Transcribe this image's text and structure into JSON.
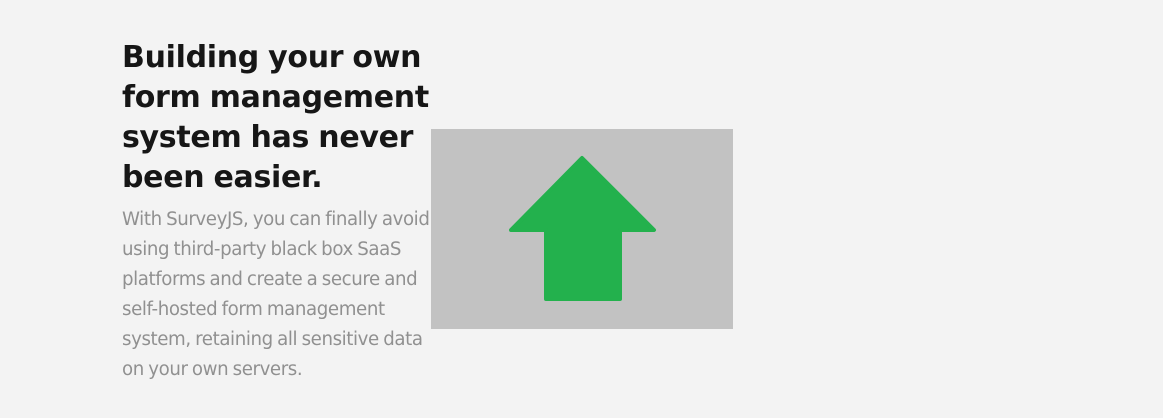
{
  "hero": {
    "title": "Building your own form management system has never been easier.",
    "description": "With SurveyJS, you can finally avoid using third-party black box SaaS platforms and create a secure and self-hosted form management system, retaining all sensitive data on your own servers."
  },
  "illustration": {
    "icon": "up-arrow-icon",
    "background_color": "#c2c2c2",
    "arrow_color": "#23b14d"
  }
}
